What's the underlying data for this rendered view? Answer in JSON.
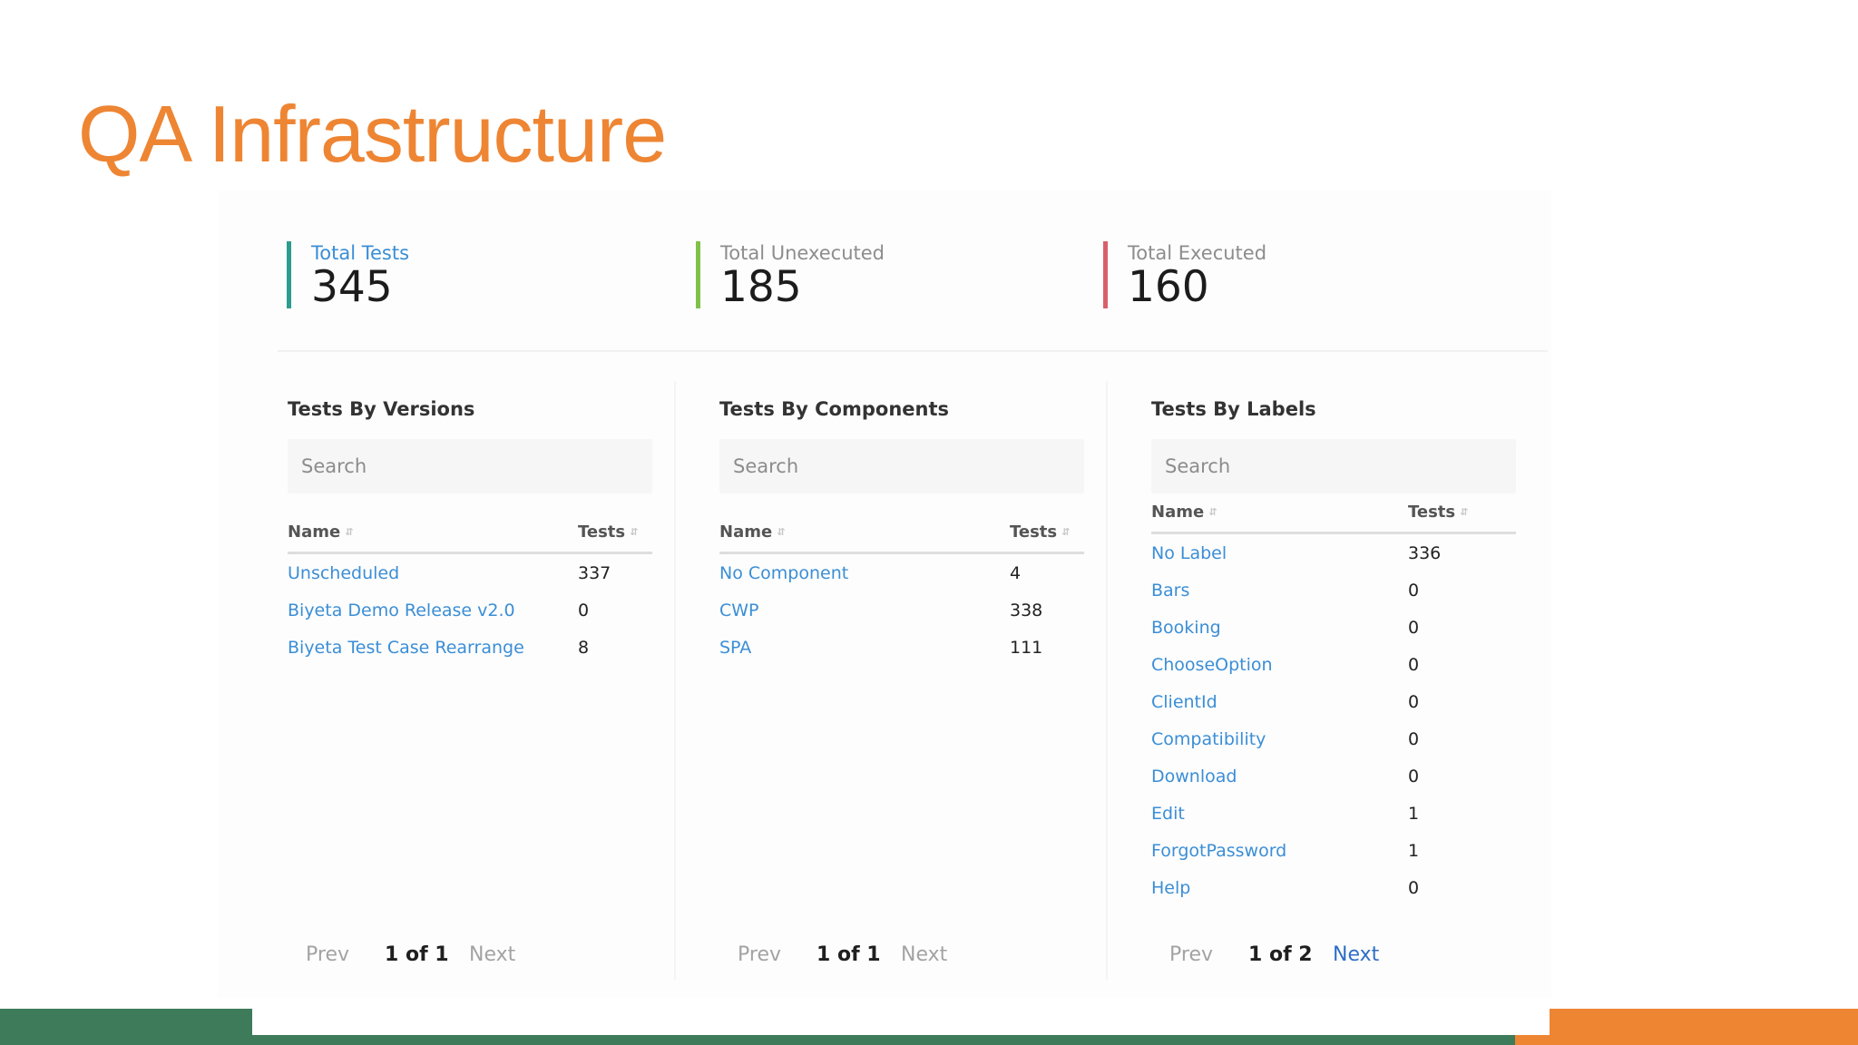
{
  "slide": {
    "title": "QA Infrastructure"
  },
  "stats": {
    "total_tests": {
      "label": "Total Tests",
      "value": "345"
    },
    "total_unexecuted": {
      "label": "Total Unexecuted",
      "value": "185"
    },
    "total_executed": {
      "label": "Total Executed",
      "value": "160"
    }
  },
  "colors": {
    "title": "#ee8533",
    "link": "#3b8ed6",
    "total_tests_bar": "#2a9d8f",
    "unexecuted_bar": "#7fc24a",
    "executed_bar": "#d9606a",
    "footer_green": "#3d7b5a",
    "footer_orange": "#ee8533"
  },
  "panels": {
    "versions": {
      "title": "Tests By Versions",
      "search_placeholder": "Search",
      "col_name": "Name",
      "col_tests": "Tests",
      "rows": [
        {
          "name": "Unscheduled",
          "tests": "337"
        },
        {
          "name": "Biyeta Demo Release v2.0",
          "tests": "0"
        },
        {
          "name": "Biyeta Test Case Rearrange",
          "tests": "8"
        }
      ],
      "pager": {
        "prev": "Prev",
        "page": "1 of 1",
        "next": "Next"
      }
    },
    "components": {
      "title": "Tests By Components",
      "search_placeholder": "Search",
      "col_name": "Name",
      "col_tests": "Tests",
      "rows": [
        {
          "name": "No Component",
          "tests": "4"
        },
        {
          "name": "CWP",
          "tests": "338"
        },
        {
          "name": "SPA",
          "tests": "111"
        }
      ],
      "pager": {
        "prev": "Prev",
        "page": "1 of 1",
        "next": "Next"
      }
    },
    "labels": {
      "title": "Tests By Labels",
      "search_placeholder": "Search",
      "col_name": "Name",
      "col_tests": "Tests",
      "rows": [
        {
          "name": "No Label",
          "tests": "336"
        },
        {
          "name": "Bars",
          "tests": "0"
        },
        {
          "name": "Booking",
          "tests": "0"
        },
        {
          "name": "ChooseOption",
          "tests": "0"
        },
        {
          "name": "ClientId",
          "tests": "0"
        },
        {
          "name": "Compatibility",
          "tests": "0"
        },
        {
          "name": "Download",
          "tests": "0"
        },
        {
          "name": "Edit",
          "tests": "1"
        },
        {
          "name": "ForgotPassword",
          "tests": "1"
        },
        {
          "name": "Help",
          "tests": "0"
        }
      ],
      "pager": {
        "prev": "Prev",
        "page": "1 of 2",
        "next": "Next"
      }
    }
  },
  "icons": {
    "sort": "sort-icon"
  }
}
